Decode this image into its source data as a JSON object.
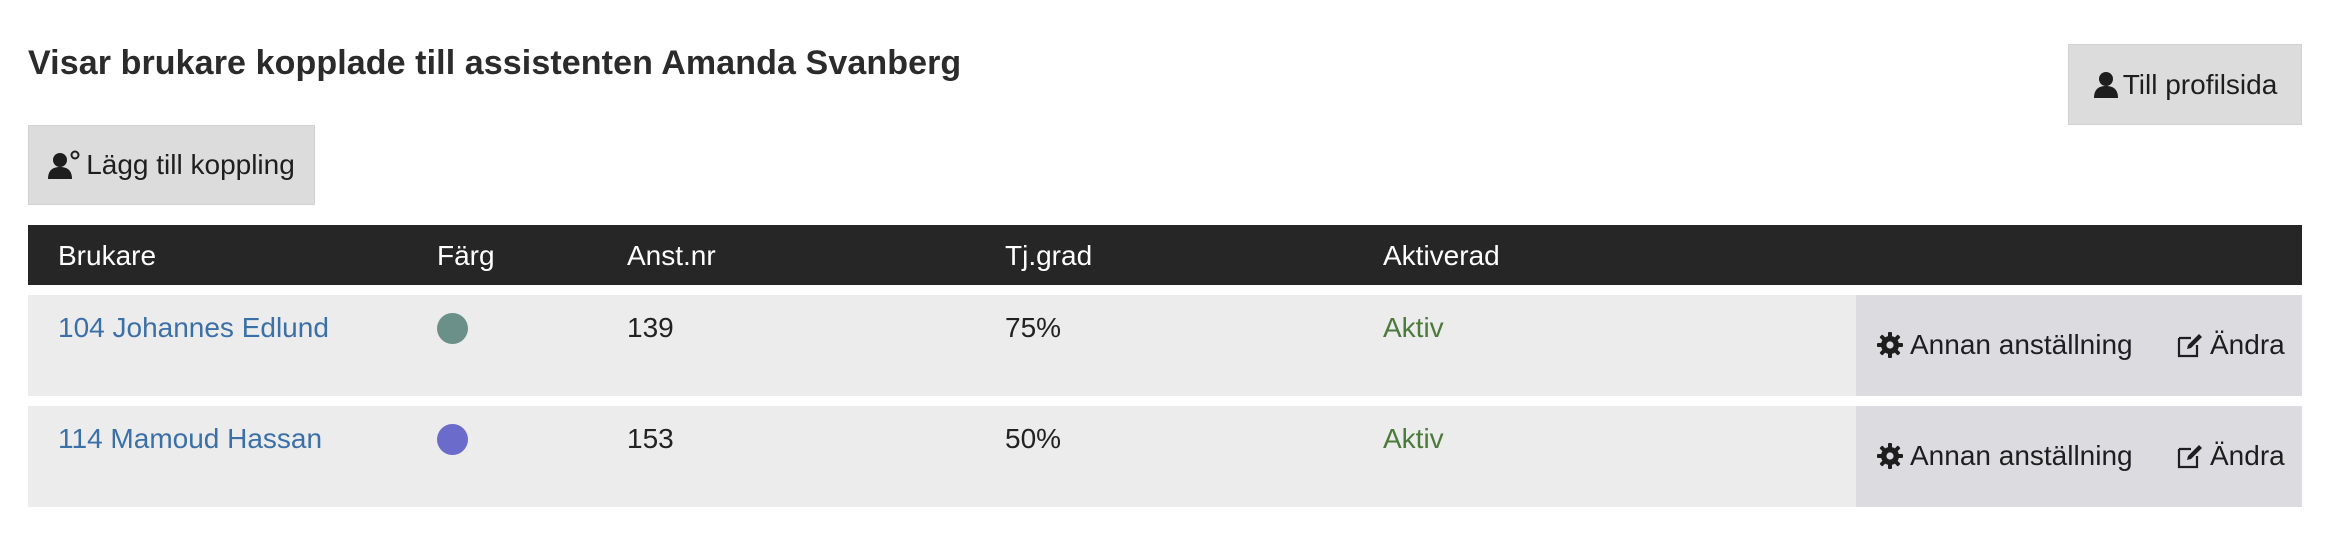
{
  "page": {
    "title": "Visar brukare kopplade till assistenten Amanda Svanberg"
  },
  "buttons": {
    "profile_label": "Till profilsida",
    "profile_icon": "user-icon",
    "add_label": "Lägg till koppling",
    "add_icon": "user-link-icon"
  },
  "table": {
    "headers": [
      "Brukare",
      "Färg",
      "Anst.nr",
      "Tj.grad",
      "Aktiverad"
    ],
    "rows": [
      {
        "brukare": "104 Johannes Edlund",
        "color": "#6b9089",
        "anst_nr": "139",
        "tj_grad": "75%",
        "aktiverad": "Aktiv",
        "action_other": "Annan anställning",
        "action_edit": "Ändra"
      },
      {
        "brukare": "114 Mamoud Hassan",
        "color": "#6b6bcc",
        "anst_nr": "153",
        "tj_grad": "50%",
        "aktiverad": "Aktiv",
        "action_other": "Annan anställning",
        "action_edit": "Ändra"
      }
    ]
  },
  "colors": {
    "header_bg": "#262626",
    "row_bg": "#ececec",
    "actions_bg": "#dcdbe0",
    "button_bg": "#dcdcdc",
    "link": "#3b6fa8",
    "status_active": "#4b7a3a"
  },
  "icons": {
    "action_other": "gear-icon",
    "action_edit": "edit-icon"
  }
}
